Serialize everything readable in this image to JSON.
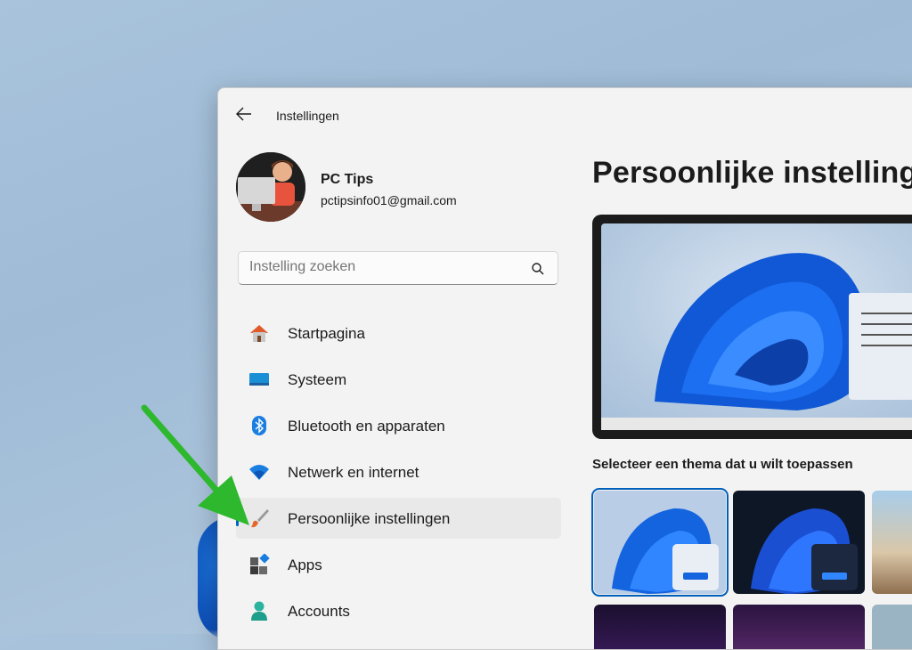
{
  "window": {
    "title": "Instellingen",
    "back_icon": "back-arrow-icon"
  },
  "profile": {
    "name": "PC Tips",
    "email": "pctipsinfo01@gmail.com"
  },
  "search": {
    "placeholder": "Instelling zoeken",
    "icon": "search-icon"
  },
  "nav": {
    "items": [
      {
        "label": "Startpagina",
        "icon": "home-icon"
      },
      {
        "label": "Systeem",
        "icon": "system-icon"
      },
      {
        "label": "Bluetooth en apparaten",
        "icon": "bluetooth-icon"
      },
      {
        "label": "Netwerk en internet",
        "icon": "wifi-icon"
      },
      {
        "label": "Persoonlijke instellingen",
        "icon": "paintbrush-icon",
        "selected": true
      },
      {
        "label": "Apps",
        "icon": "apps-icon"
      },
      {
        "label": "Accounts",
        "icon": "accounts-icon"
      }
    ]
  },
  "main": {
    "title": "Persoonlijke instellingen",
    "themes_label": "Selecteer een thema dat u wilt toepassen"
  },
  "colors": {
    "accent": "#0067c0",
    "annotation_arrow": "#2eb82e"
  }
}
